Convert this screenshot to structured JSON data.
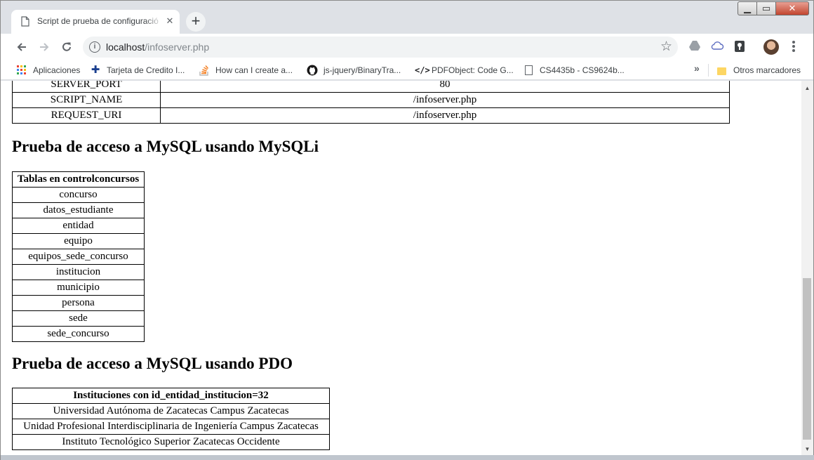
{
  "browser": {
    "tab_title": "Script de prueba de configuració",
    "url_host": "localhost",
    "url_path": "/infoserver.php",
    "bookmarks": [
      {
        "label": "Aplicaciones",
        "icon": "apps-grid-icon"
      },
      {
        "label": "Tarjeta de Credito I...",
        "icon": "puzzle-icon"
      },
      {
        "label": "How can I create a...",
        "icon": "stackoverflow-icon"
      },
      {
        "label": "js-jquery/BinaryTra...",
        "icon": "github-icon"
      },
      {
        "label": "PDFObject: Code G...",
        "icon": "code-icon"
      },
      {
        "label": "CS4435b - CS9624b...",
        "icon": "page-icon"
      }
    ],
    "overflow_label": "»",
    "other_bookmarks": "Otros marcadores"
  },
  "server_table": {
    "rows": [
      {
        "key": "SERVER_PORT",
        "value": "80"
      },
      {
        "key": "SCRIPT_NAME",
        "value": "/infoserver.php"
      },
      {
        "key": "REQUEST_URI",
        "value": "/infoserver.php"
      }
    ]
  },
  "mysqli": {
    "heading": "Prueba de acceso a MySQL usando MySQLi",
    "table_header": "Tablas en controlconcursos",
    "tables": [
      "concurso",
      "datos_estudiante",
      "entidad",
      "equipo",
      "equipos_sede_concurso",
      "institucion",
      "municipio",
      "persona",
      "sede",
      "sede_concurso"
    ]
  },
  "pdo": {
    "heading": "Prueba de acceso a MySQL usando PDO",
    "table_header": "Instituciones con id_entidad_institucion=32",
    "institutions": [
      "Universidad Autónoma de Zacatecas Campus Zacatecas",
      "Unidad Profesional Interdisciplinaria de Ingeniería Campus Zacatecas",
      "Instituto Tecnológico Superior Zacatecas Occidente"
    ]
  }
}
